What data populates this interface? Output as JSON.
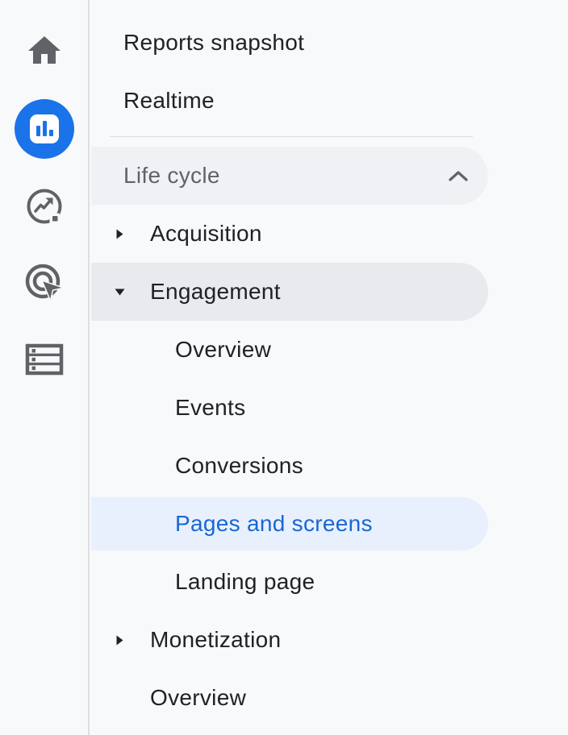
{
  "colors": {
    "background": "#f8f9fa",
    "rail_divider": "#dcdee1",
    "text": "#202124",
    "muted_text": "#5f6368",
    "accent_blue": "#1a73e8",
    "selected_text": "#1967d2",
    "selected_item_bg": "#e8f0fe",
    "expanded_section_bg": "#e8eaed",
    "collection_header_bg": "#f0f1f4"
  },
  "rail": {
    "icons": [
      {
        "name": "home-icon",
        "active": false
      },
      {
        "name": "reports-icon",
        "active": true
      },
      {
        "name": "explore-icon",
        "active": false
      },
      {
        "name": "advertising-icon",
        "active": false
      },
      {
        "name": "library-icon",
        "active": false
      }
    ]
  },
  "menu": {
    "items": [
      {
        "label": "Reports snapshot",
        "type": "link"
      },
      {
        "label": "Realtime",
        "type": "link"
      },
      {
        "label": "Life cycle",
        "type": "collection-header",
        "collapse_icon": "chevron-up-icon"
      },
      {
        "label": "Acquisition",
        "type": "section",
        "state": "collapsed"
      },
      {
        "label": "Engagement",
        "type": "section",
        "state": "expanded"
      },
      {
        "label": "Overview",
        "type": "sub-item"
      },
      {
        "label": "Events",
        "type": "sub-item"
      },
      {
        "label": "Conversions",
        "type": "sub-item"
      },
      {
        "label": "Pages and screens",
        "type": "sub-item",
        "selected": true
      },
      {
        "label": "Landing page",
        "type": "sub-item"
      },
      {
        "label": "Monetization",
        "type": "section",
        "state": "collapsed"
      },
      {
        "label": "Overview",
        "type": "link"
      }
    ]
  }
}
